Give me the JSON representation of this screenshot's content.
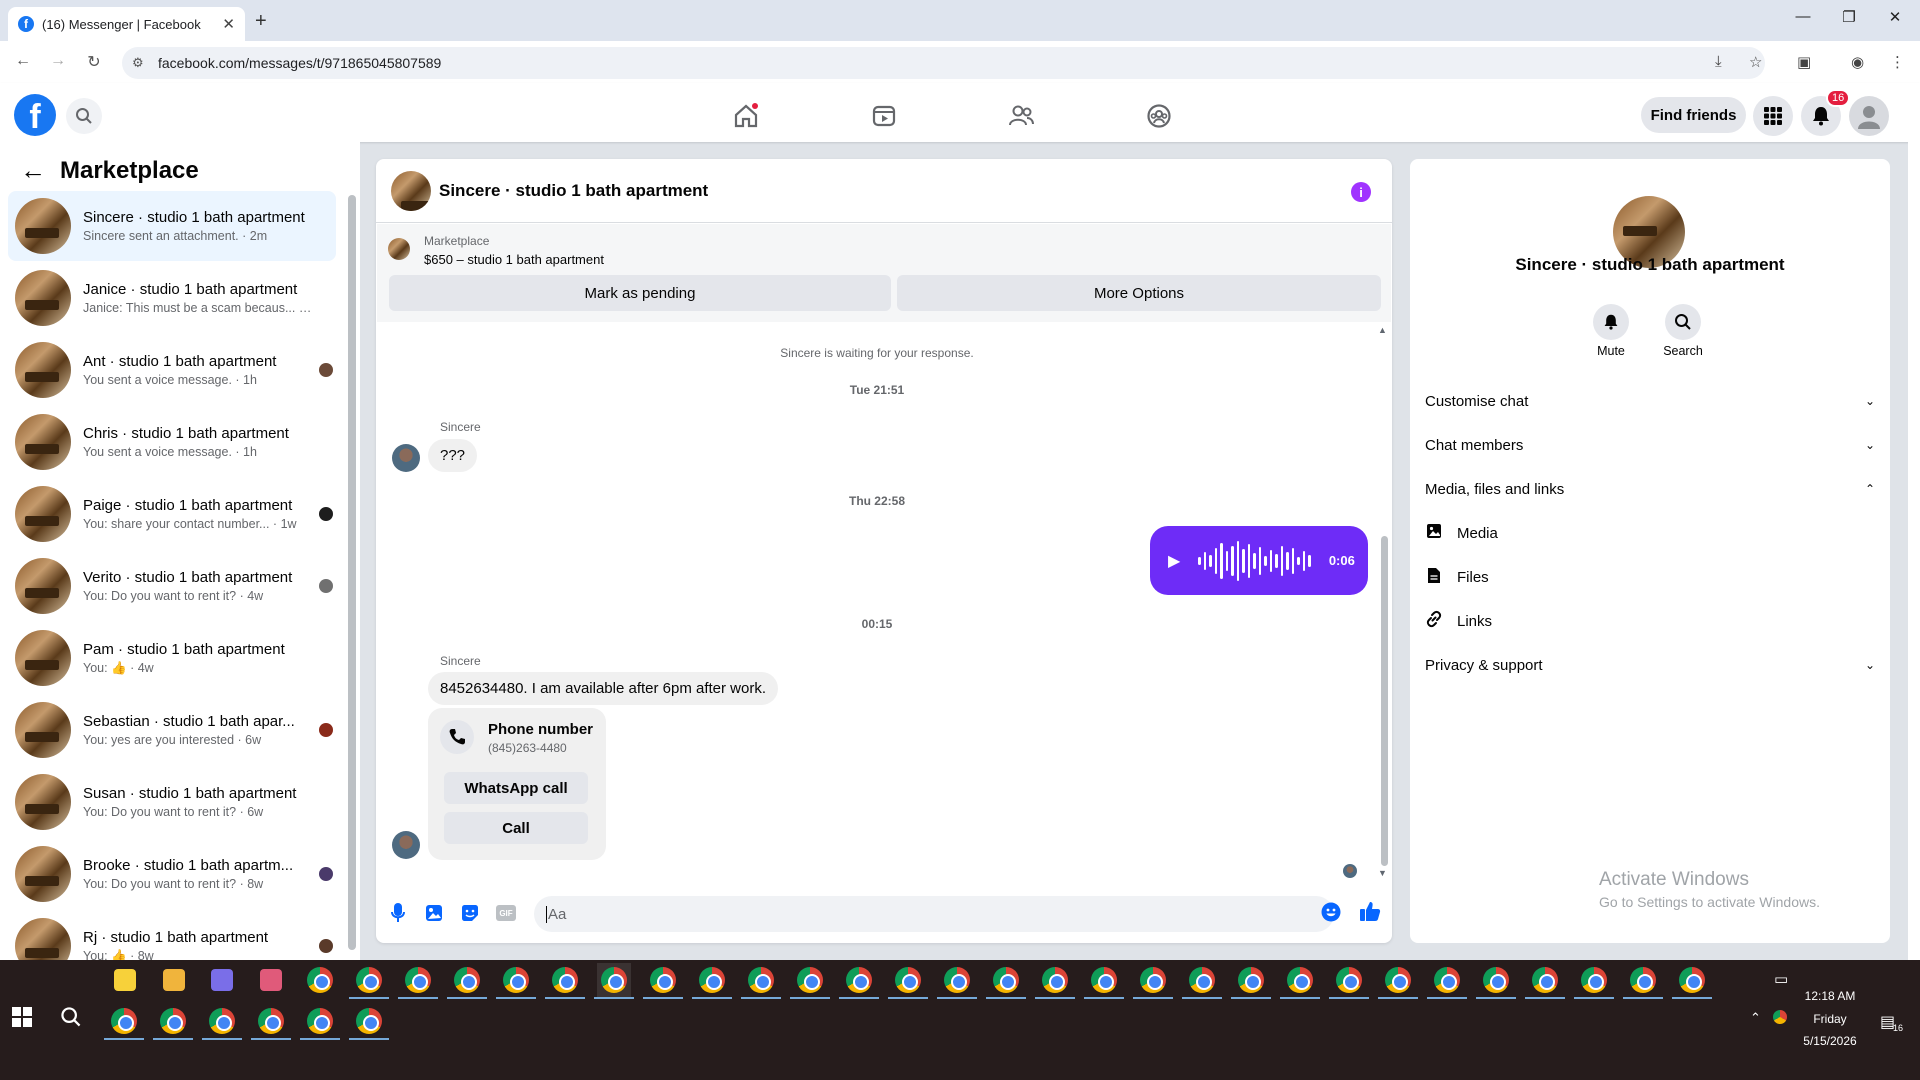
{
  "browser": {
    "tab_title": "(16) Messenger | Facebook",
    "url": "facebook.com/messages/t/971865045807589"
  },
  "header": {
    "find_friends": "Find friends",
    "notification_count": "16"
  },
  "left": {
    "title": "Marketplace",
    "conversations": [
      {
        "name": "Sincere · studio 1 bath apartment",
        "preview": "Sincere sent an attachment. · 2m",
        "active": true
      },
      {
        "name": "Janice · studio 1 bath apartment",
        "preview": "Janice: This must be a scam becaus... · 1h"
      },
      {
        "name": "Ant · studio 1 bath apartment",
        "preview": "You sent a voice message. · 1h"
      },
      {
        "name": "Chris · studio 1 bath apartment",
        "preview": "You sent a voice message. · 1h"
      },
      {
        "name": "Paige · studio 1 bath apartment",
        "preview": "You: share your contact number... · 1w"
      },
      {
        "name": "Verito · studio 1 bath apartment",
        "preview": "You: Do you want to rent it? · 4w"
      },
      {
        "name": "Pam · studio 1 bath apartment",
        "preview": "You: 👍 · 4w"
      },
      {
        "name": "Sebastian · studio 1 bath apar...",
        "preview": "You: yes are you interested · 6w"
      },
      {
        "name": "Susan · studio 1 bath apartment",
        "preview": "You: Do you want to rent it? · 6w"
      },
      {
        "name": "Brooke · studio 1 bath apartm...",
        "preview": "You: Do you want to rent it? · 8w"
      },
      {
        "name": "Rj · studio 1 bath apartment",
        "preview": "You: 👍 · 8w"
      }
    ]
  },
  "chat": {
    "title": "Sincere · studio 1 bath apartment",
    "marketplace_label": "Marketplace",
    "listing": "$650 – studio 1 bath apartment",
    "mark_pending": "Mark as pending",
    "more_options": "More Options",
    "waiting": "Sincere is waiting for your response.",
    "ts1": "Tue 21:51",
    "sender1": "Sincere",
    "msg1": "???",
    "ts2": "Thu 22:58",
    "voice_duration": "0:06",
    "ts3": "00:15",
    "sender2": "Sincere",
    "msg2": "8452634480. I am available after 6pm after work.",
    "phone_title": "Phone number",
    "phone_number": "(845)263-4480",
    "whatsapp_call": "WhatsApp call",
    "call": "Call",
    "composer_placeholder": "Aa"
  },
  "right": {
    "name": "Sincere · studio 1 bath apartment",
    "mute": "Mute",
    "search": "Search",
    "customise": "Customise chat",
    "members": "Chat members",
    "media_files_links": "Media, files and links",
    "media": "Media",
    "files": "Files",
    "links": "Links",
    "privacy": "Privacy & support",
    "activate_title": "Activate Windows",
    "activate_sub": "Go to Settings to activate Windows."
  },
  "taskbar": {
    "time": "12:18 AM",
    "day": "Friday",
    "date": "5/15/2026",
    "notif_count": "16"
  },
  "colors": {
    "fb_blue": "#1877f2",
    "messenger_purple": "#6e2cf7",
    "active_conv": "#ebf5ff"
  }
}
